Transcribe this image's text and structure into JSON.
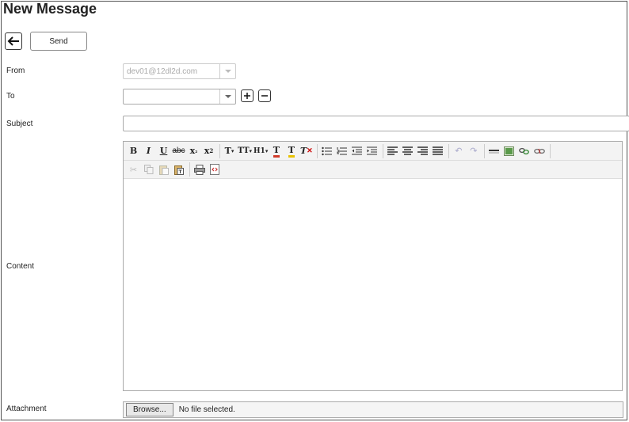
{
  "page": {
    "title": "New Message"
  },
  "actions": {
    "send_label": "Send"
  },
  "form": {
    "from_label": "From",
    "from_value": "dev01@12dl2d.com",
    "to_label": "To",
    "to_value": "",
    "subject_label": "Subject",
    "subject_value": "",
    "content_label": "Content",
    "attachment_label": "Attachment",
    "browse_label": "Browse...",
    "no_file_text": "No file selected."
  },
  "editor": {
    "toolbar_row1": [
      {
        "name": "bold-icon",
        "glyph": "B"
      },
      {
        "name": "italic-icon",
        "glyph": "I"
      },
      {
        "name": "underline-icon",
        "glyph": "U"
      },
      {
        "name": "strikethrough-icon",
        "glyph": "abc"
      },
      {
        "name": "subscript-icon",
        "glyph": "x₂"
      },
      {
        "name": "superscript-icon",
        "glyph": "x²"
      },
      {
        "name": "font-family-icon",
        "glyph": "T▾"
      },
      {
        "name": "font-size-icon",
        "glyph": "tT▾"
      },
      {
        "name": "heading-icon",
        "glyph": "H1▾"
      },
      {
        "name": "text-color-icon",
        "glyph": "T"
      },
      {
        "name": "highlight-color-icon",
        "glyph": "T"
      },
      {
        "name": "remove-format-icon",
        "glyph": "T"
      },
      {
        "name": "bulleted-list-icon",
        "glyph": "☰"
      },
      {
        "name": "numbered-list-icon",
        "glyph": "☰"
      },
      {
        "name": "outdent-icon",
        "glyph": "⇤"
      },
      {
        "name": "indent-icon",
        "glyph": "⇥"
      },
      {
        "name": "align-left-icon",
        "glyph": "≡"
      },
      {
        "name": "align-center-icon",
        "glyph": "≡"
      },
      {
        "name": "align-right-icon",
        "glyph": "≡"
      },
      {
        "name": "justify-icon",
        "glyph": "≡"
      },
      {
        "name": "undo-icon",
        "glyph": "↶"
      },
      {
        "name": "redo-icon",
        "glyph": "↷"
      },
      {
        "name": "horizontal-rule-icon",
        "glyph": "▬"
      },
      {
        "name": "insert-image-icon",
        "glyph": "▣"
      },
      {
        "name": "insert-link-icon",
        "glyph": "∞"
      },
      {
        "name": "remove-link-icon",
        "glyph": "⊘"
      }
    ],
    "toolbar_row2": [
      {
        "name": "cut-icon",
        "glyph": "✂"
      },
      {
        "name": "copy-icon",
        "glyph": "❐"
      },
      {
        "name": "paste-icon",
        "glyph": "📋"
      },
      {
        "name": "paste-text-icon",
        "glyph": "📋"
      },
      {
        "name": "print-icon",
        "glyph": "⎙"
      },
      {
        "name": "source-code-icon",
        "glyph": "‹›"
      }
    ]
  },
  "colors": {
    "text_color_accent": "#d13b2a",
    "highlight_accent": "#e8c200",
    "remove_format_accent": "#cc0000",
    "icon_gray": "#aaaaaa"
  }
}
